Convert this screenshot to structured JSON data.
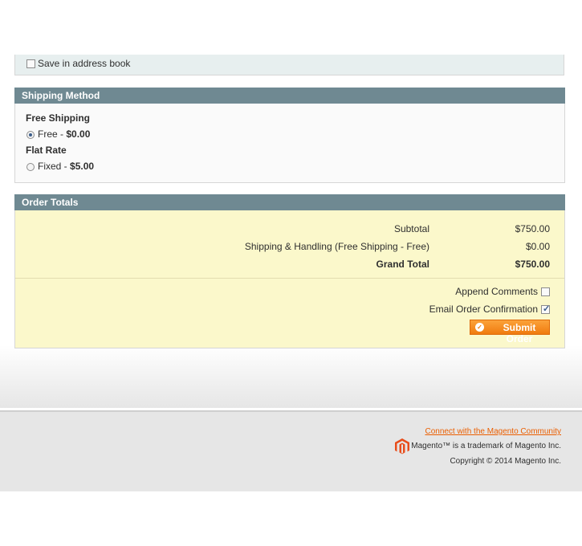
{
  "address": {
    "save_label": "Save in address book",
    "save_checked": false
  },
  "shipping": {
    "title": "Shipping Method",
    "groups": [
      {
        "name": "Free Shipping",
        "option_label": "Free - ",
        "price": "$0.00",
        "selected": true
      },
      {
        "name": "Flat Rate",
        "option_label": "Fixed - ",
        "price": "$5.00",
        "selected": false
      }
    ]
  },
  "totals": {
    "title": "Order Totals",
    "rows": [
      {
        "label": "Subtotal",
        "value": "$750.00"
      },
      {
        "label": "Shipping & Handling (Free Shipping - Free)",
        "value": "$0.00"
      },
      {
        "label": "Grand Total",
        "value": "$750.00"
      }
    ],
    "append_comments_label": "Append Comments",
    "append_comments_checked": false,
    "email_confirmation_label": "Email Order Confirmation",
    "email_confirmation_checked": true,
    "submit_label": "Submit Order"
  },
  "footer": {
    "community_link": "Connect with the Magento Community",
    "trademark": "Magento™ is a trademark of Magento Inc.",
    "copyright": "Copyright © 2014 Magento Inc."
  },
  "colors": {
    "header_bar": "#6f8992",
    "totals_bg": "#fbf8cb",
    "button_orange": "#f07b0f",
    "link_orange": "#eb5e00",
    "logo_red": "#e84e1c"
  },
  "icons": {
    "submit": "check-circle-icon",
    "logo": "magento-logo-icon"
  }
}
